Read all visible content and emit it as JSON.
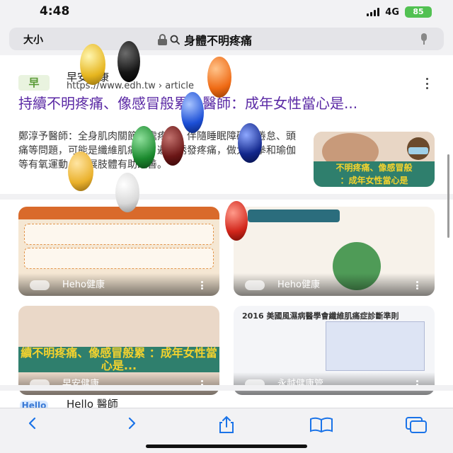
{
  "status_bar": {
    "time": "4:48",
    "network": "4G",
    "battery": "85"
  },
  "address_bar": {
    "text_size_label": "大小",
    "query": "身體不明疼痛"
  },
  "result": {
    "site_logo": "早",
    "site_name": "早安健康",
    "url": "https://www.edh.tw › article",
    "title": "持續不明疼痛、像感冒般累！醫師：成年女性當心是...",
    "snippet": "鄭淳予醫師：全身肌肉關節多處疼痛、伴隨睡眠障礙、倦怠、頭痛等問題，可能是纖維肌痛症。避免誘發疼痛，做太極拳和瑜伽等有氧運動、伸展肢體有助改善。",
    "thumbnail_caption_line1": "不明疼痛、像感冒般",
    "thumbnail_caption_line2": "：成年女性當心是"
  },
  "image_cards": [
    {
      "source": "Heho健康"
    },
    {
      "source": "Heho健康"
    },
    {
      "source": "早安健康",
      "caption": "續不明疼痛、像感冒般累 ：成年女性當心是..."
    },
    {
      "source": "永越健康管...",
      "title": "2016 美國風濕病醫學會纖維肌痛症診斷準則"
    }
  ],
  "next_result": {
    "logo": "Hello",
    "title": "Hello 醫師"
  },
  "toolbar": {
    "back": "‹",
    "forward": "›"
  },
  "colors": {
    "title": "#5b2aa5",
    "link_blue": "#1a73e8",
    "battery": "#52c152"
  }
}
